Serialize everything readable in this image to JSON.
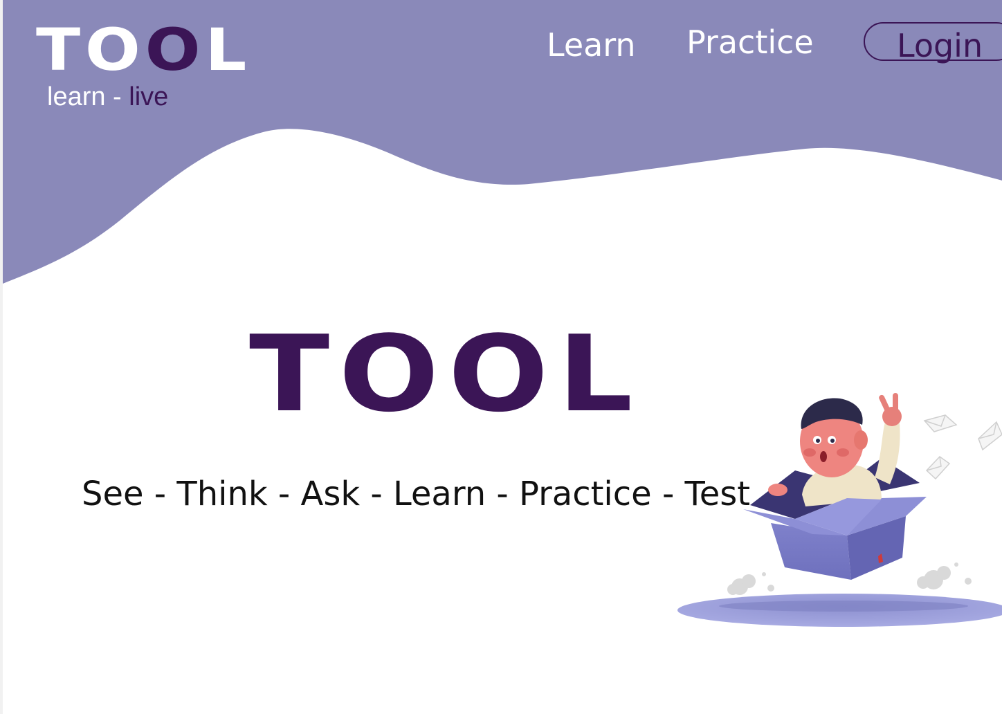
{
  "brand": {
    "logo_part1": "TO",
    "logo_highlight": "O",
    "logo_part2": "L",
    "tagline_prefix": "learn - ",
    "tagline_highlight": "live"
  },
  "nav": {
    "learn_label": "Learn",
    "practice_label": "Practice",
    "login_label": "Login"
  },
  "hero": {
    "title": "TOOL",
    "subtitle": "See - Think - Ask - Learn - Practice - Test"
  },
  "colors": {
    "header_bg": "#8a89b9",
    "brand_dark": "#3b1556",
    "box": "#7b7cc8",
    "shadow_ellipse": "#9c9fdb"
  },
  "illustration": {
    "icon": "boy-in-box-illustration"
  }
}
